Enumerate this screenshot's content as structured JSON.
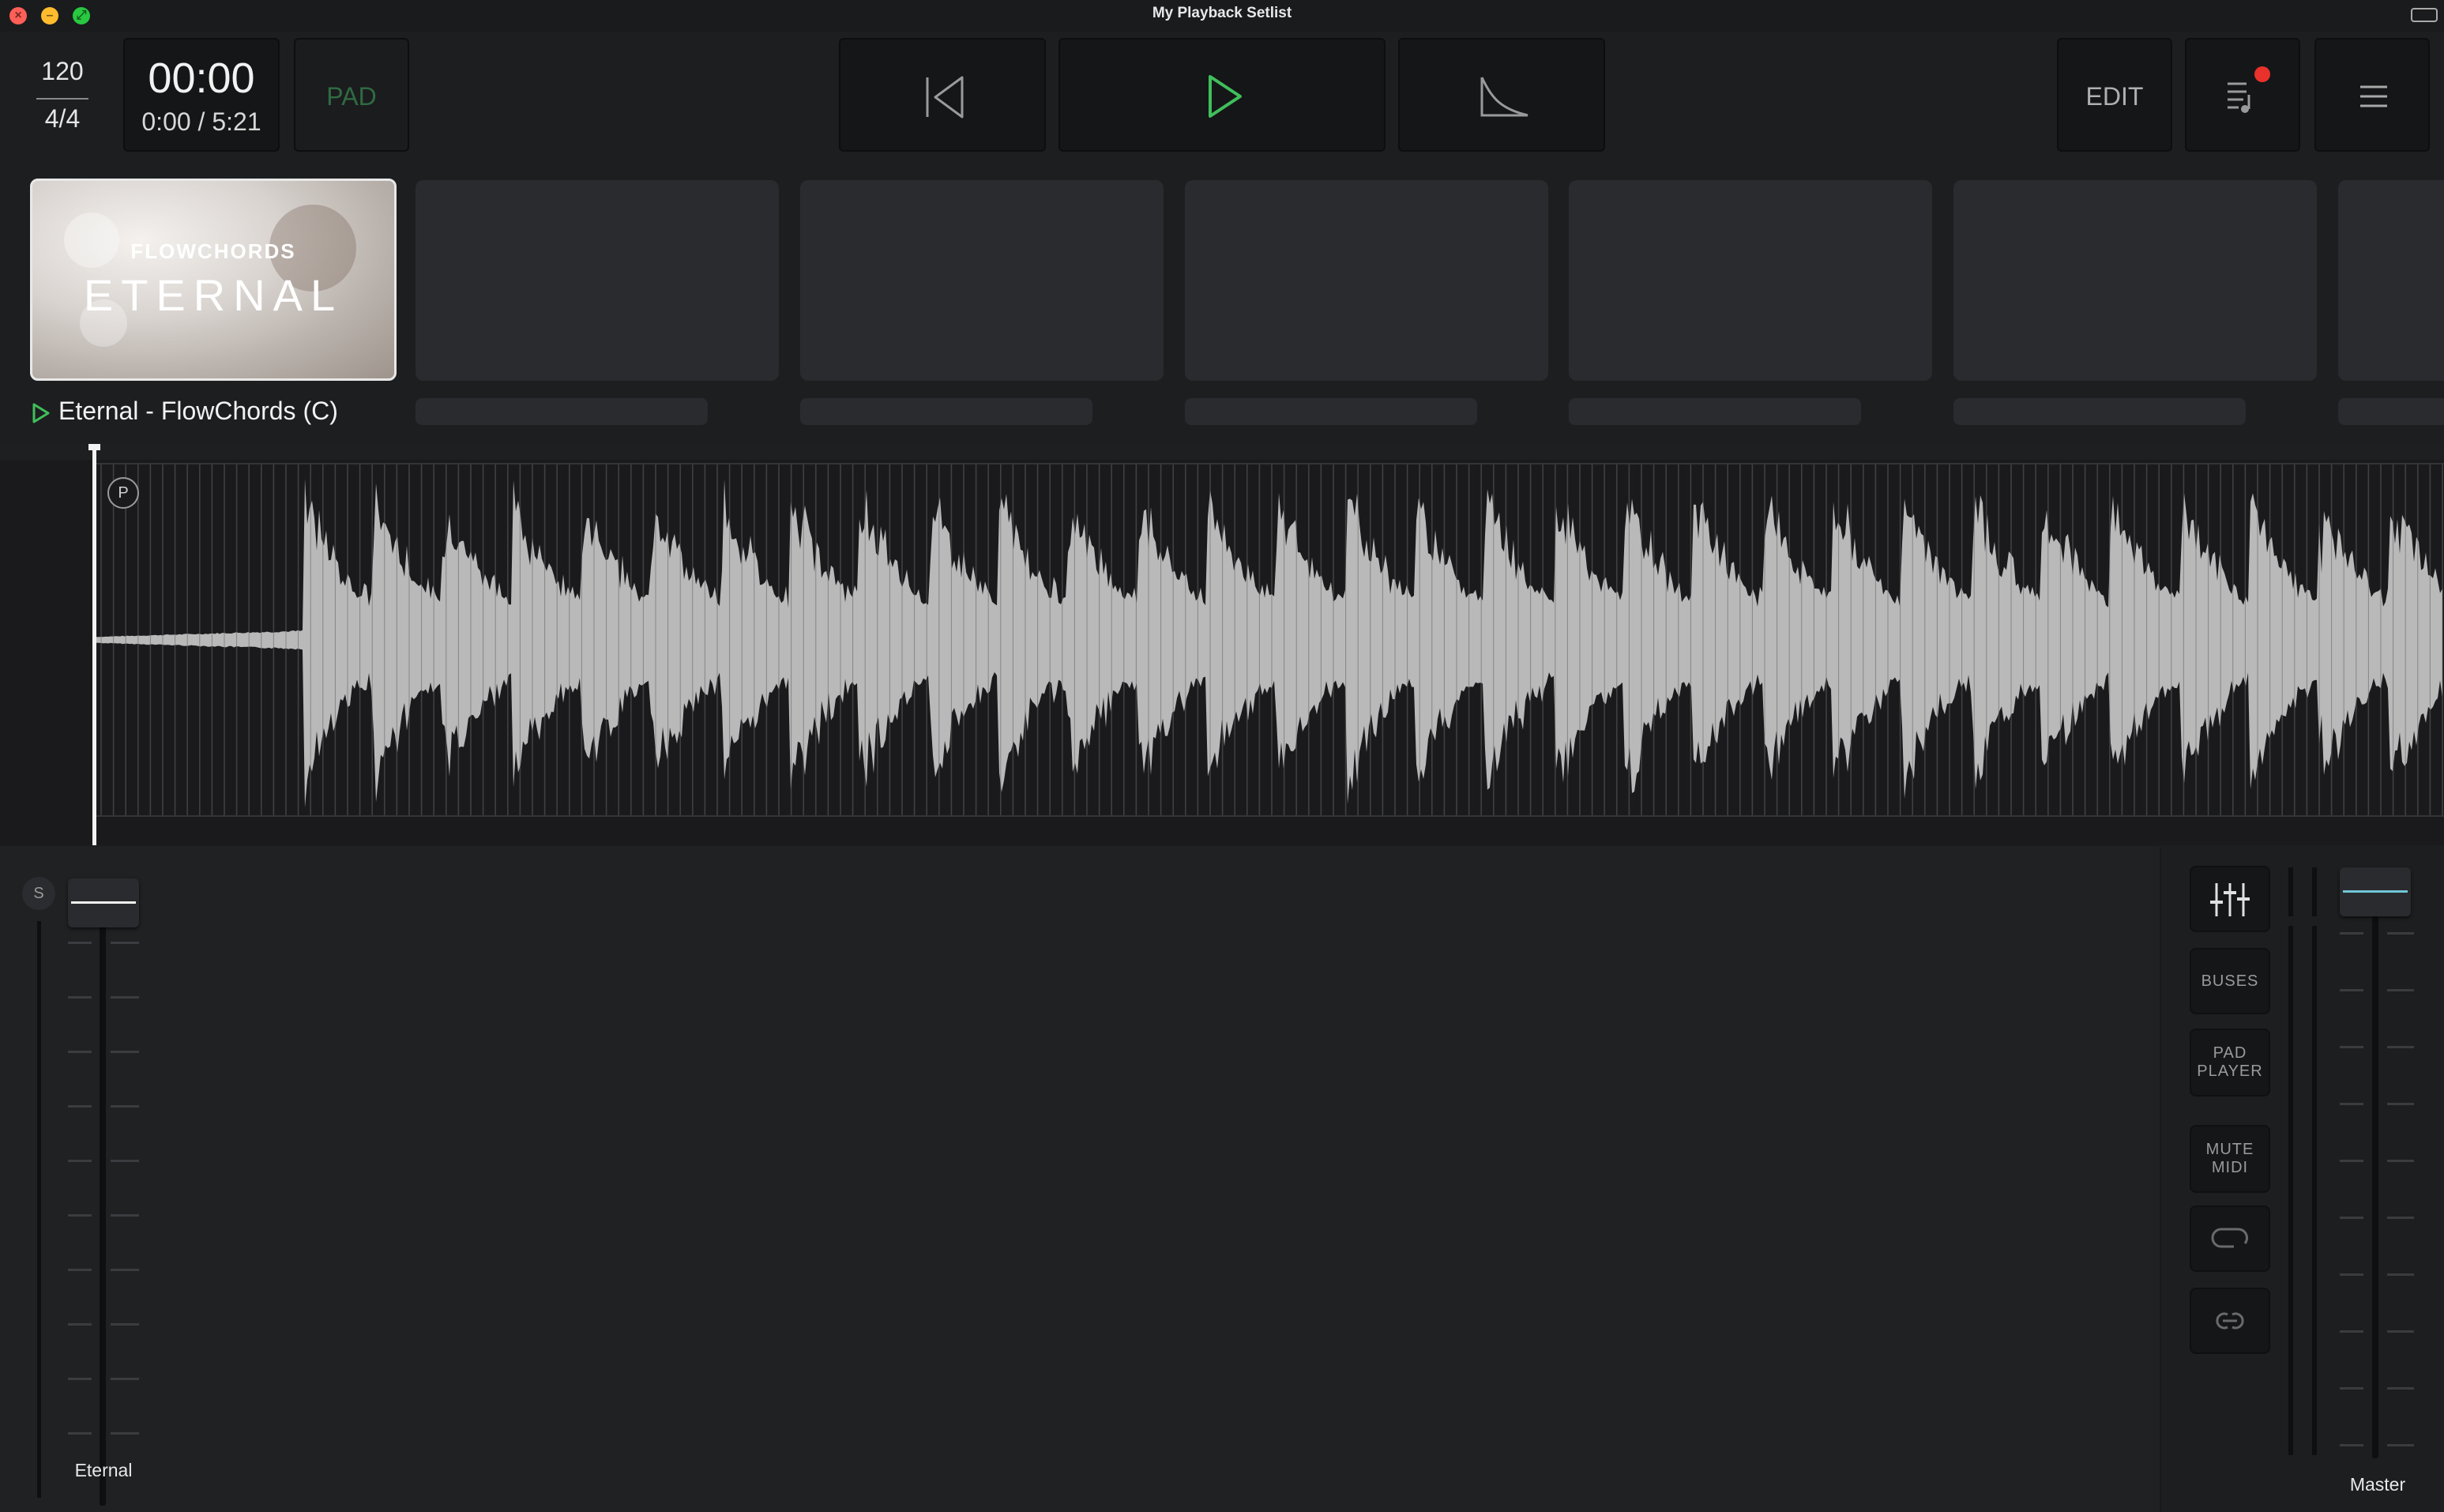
{
  "window": {
    "title": "My Playback Setlist"
  },
  "transport": {
    "tempo": "120",
    "time_signature": "4/4",
    "clock": "00:00",
    "position": "0:00 / 5:21",
    "pad_label": "PAD",
    "edit_label": "EDIT"
  },
  "setlist": {
    "active_song": {
      "title": "Eternal - FlowChords (C)",
      "artwork_brand": "FLOWCHORDS",
      "artwork_title": "ETERNAL"
    }
  },
  "waveform": {
    "marker_label": "P"
  },
  "mixer": {
    "channels": [
      {
        "name": "Eternal",
        "solo_label": "S"
      }
    ],
    "master_label": "Master",
    "side_buttons": [
      {
        "icon": "sliders-icon"
      },
      {
        "label": "BUSES"
      },
      {
        "label_line1": "PAD",
        "label_line2": "PLAYER"
      },
      {
        "label_line1": "MUTE",
        "label_line2": "MIDI"
      },
      {
        "icon": "loop-icon"
      },
      {
        "icon": "link-icon"
      }
    ]
  },
  "colors": {
    "accent_green": "#3fbf5a",
    "pad_green": "#2f6b43",
    "notification_red": "#e8322b",
    "master_fader_cyan": "#6fc6d6"
  }
}
